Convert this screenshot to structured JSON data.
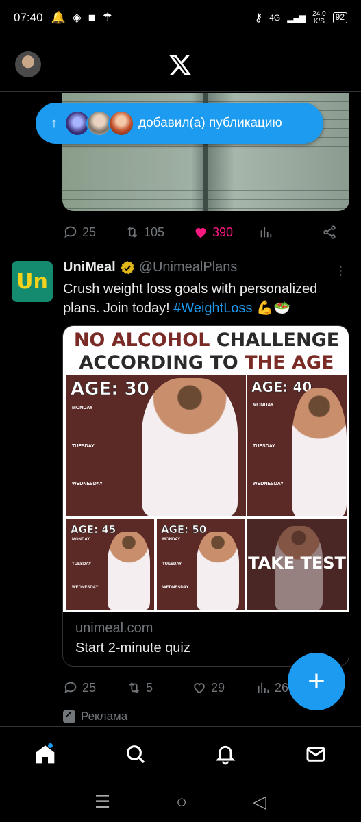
{
  "status_bar": {
    "time": "07:40",
    "network_label": "4G",
    "speed_value": "24,0",
    "speed_unit": "K/S",
    "battery": "92"
  },
  "new_posts_pill": {
    "label": "добавил(а) публикацию"
  },
  "post1": {
    "replies": "25",
    "reposts": "105",
    "likes": "390"
  },
  "ad": {
    "logo_text": "Un",
    "name": "UniMeal",
    "handle": "@UnimealPlans",
    "text_main": "Crush weight loss goals with personalized plans. Join today! ",
    "hashtag": "#WeightLoss",
    "emojis": " 💪🥗",
    "card": {
      "title_part1": "NO ALCOHOL",
      "title_part2": " CHALLENGE",
      "title_line2_part1": "ACCORDING TO ",
      "title_line2_part2": "THE AGE",
      "tiles": [
        {
          "age": "AGE: 30",
          "days": [
            "MONDAY",
            "TUESDAY",
            "WEDNESDAY"
          ]
        },
        {
          "age": "AGE: 40",
          "days": [
            "MONDAY",
            "TUESDAY",
            "WEDNESDAY"
          ]
        },
        {
          "age": "AGE: 45",
          "days": [
            "MONDAY",
            "TUESDAY",
            "WEDNESDAY"
          ]
        },
        {
          "age": "AGE: 50",
          "days": [
            "MONDAY",
            "TUESDAY",
            "WEDNESDAY"
          ]
        }
      ],
      "take_test": "TAKE TEST",
      "domain": "unimeal.com",
      "cta": "Start 2-minute quiz"
    },
    "replies": "25",
    "reposts": "5",
    "likes": "29",
    "views": "26",
    "promoted_label": "Реклама"
  },
  "colors": {
    "accent": "#1d9bf0",
    "like": "#f91880",
    "muted": "#71767b"
  }
}
